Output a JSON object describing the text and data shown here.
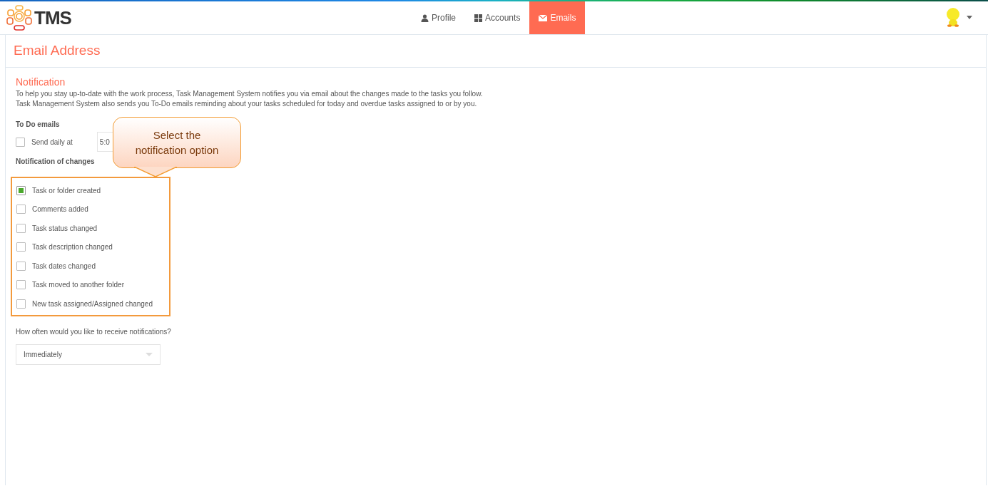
{
  "app": {
    "logo_text": "TMS"
  },
  "nav": [
    {
      "label": "Profile",
      "selected": false
    },
    {
      "label": "Accounts",
      "selected": false
    },
    {
      "label": "Emails",
      "selected": true
    }
  ],
  "page_title": "Email Address",
  "section": {
    "title": "Notification",
    "description": [
      "To help you stay up-to-date with the work process, Task Management System notifies you via email about the changes made to the tasks you follow.",
      "Task Management System also sends you To-Do emails reminding about your tasks scheduled for today and overdue tasks assigned to or by you."
    ]
  },
  "todo": {
    "heading": "To Do emails",
    "label": "Send daily at",
    "checked": false,
    "time": "5:0"
  },
  "changes": {
    "heading": "Notification of changes",
    "options": [
      {
        "label": "Task or folder created",
        "checked": true
      },
      {
        "label": "Comments added",
        "checked": false
      },
      {
        "label": "Task status changed",
        "checked": false
      },
      {
        "label": "Task description changed",
        "checked": false
      },
      {
        "label": "Task dates changed",
        "checked": false
      },
      {
        "label": "Task moved to another folder",
        "checked": false
      },
      {
        "label": "New task assigned/Assigned changed",
        "checked": false
      }
    ]
  },
  "frequency": {
    "question": "How often would you like to receive notifications?",
    "value": "Immediately"
  },
  "callout": {
    "text": "Select the notification option"
  }
}
